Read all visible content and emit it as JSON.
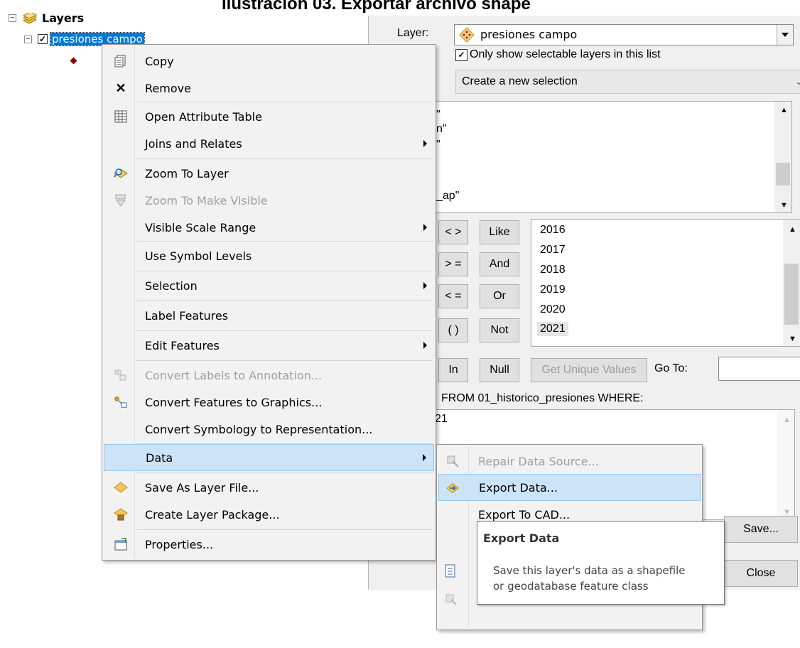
{
  "caption": "Ilustración 03. Exportar archivo shape",
  "toc": {
    "root_label": "Layers",
    "layer_label": "presiones campo"
  },
  "dialog": {
    "layer_label": "Layer:",
    "layer_value": "presiones campo",
    "only_selectable_label": "Only show selectable layers in this list",
    "method_value": "Create a new selection",
    "fields": [
      "\"",
      "n\"",
      "\"",
      "_ap\""
    ],
    "operators": [
      "< >",
      "Like",
      "> =",
      "And",
      "< =",
      "Or",
      "( )",
      "Not",
      "In",
      "Null"
    ],
    "values_list": [
      "2016",
      "2017",
      "2018",
      "2019",
      "2020",
      "2021"
    ],
    "get_unique_label": "Get Unique Values",
    "goto_label": "Go To:",
    "sql_prefix": "FROM 01_historico_presiones WHERE:",
    "sql_text": "21",
    "save_label": "Save...",
    "close_label": "Close"
  },
  "context_menu": {
    "items": [
      {
        "label": "Copy",
        "icon": "copy-icon"
      },
      {
        "label": "Remove",
        "icon": "remove-icon"
      },
      {
        "label": "Open Attribute Table",
        "icon": "table-icon"
      },
      {
        "label": "Joins and Relates",
        "icon": ""
      },
      {
        "label": "Zoom To Layer",
        "icon": "zoom-layer-icon"
      },
      {
        "label": "Zoom To Make Visible",
        "icon": "zoom-visible-icon"
      },
      {
        "label": "Visible Scale Range",
        "icon": ""
      },
      {
        "label": "Use Symbol Levels",
        "icon": ""
      },
      {
        "label": "Selection",
        "icon": ""
      },
      {
        "label": "Label Features",
        "icon": ""
      },
      {
        "label": "Edit Features",
        "icon": ""
      },
      {
        "label": "Convert Labels to Annotation...",
        "icon": "annotation-icon"
      },
      {
        "label": "Convert Features to Graphics...",
        "icon": "graphics-icon"
      },
      {
        "label": "Convert Symbology to Representation...",
        "icon": ""
      },
      {
        "label": "Data",
        "icon": ""
      },
      {
        "label": "Save As Layer File...",
        "icon": "layer-file-icon"
      },
      {
        "label": "Create Layer Package...",
        "icon": "layer-package-icon"
      },
      {
        "label": "Properties...",
        "icon": "properties-icon"
      }
    ]
  },
  "data_submenu": {
    "items": [
      {
        "label": "Repair Data Source..."
      },
      {
        "label": "Export Data..."
      },
      {
        "label": "Export To CAD..."
      }
    ]
  },
  "tooltip": {
    "title": "Export Data",
    "body_line1": "Save this layer's data as a shapefile",
    "body_line2": "or geodatabase feature class"
  },
  "colors": {
    "highlight": "#cce4f7",
    "highlight_border": "#99c9ef",
    "layer_selected": "#0078d7"
  }
}
